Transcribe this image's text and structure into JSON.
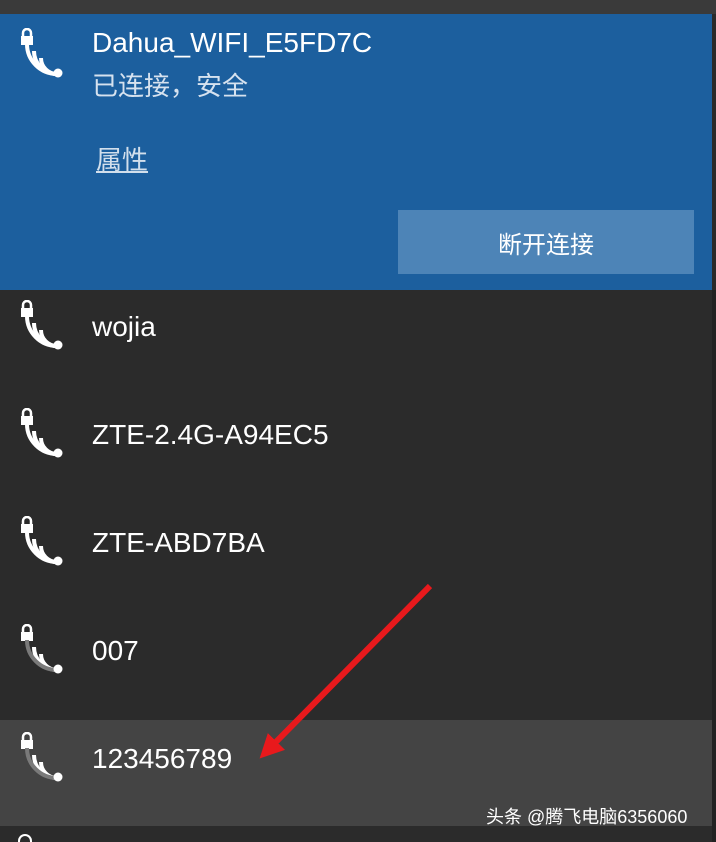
{
  "connected": {
    "ssid": "Dahua_WIFI_E5FD7C",
    "status": "已连接，安全",
    "properties_label": "属性",
    "disconnect_label": "断开连接",
    "icon": "secured-wifi-icon",
    "accent": "#1c5f9e"
  },
  "networks": [
    {
      "ssid": "wojia",
      "icon": "secured-wifi-icon",
      "signal_bars": 4
    },
    {
      "ssid": "ZTE-2.4G-A94EC5",
      "icon": "secured-wifi-icon",
      "signal_bars": 4
    },
    {
      "ssid": "ZTE-ABD7BA",
      "icon": "secured-wifi-icon",
      "signal_bars": 4
    },
    {
      "ssid": "007",
      "icon": "secured-wifi-icon",
      "signal_bars": 2
    },
    {
      "ssid": "123456789",
      "icon": "secured-wifi-icon",
      "signal_bars": 2,
      "highlighted": true
    }
  ],
  "watermark": "头条 @腾飞电脑6356060",
  "annotation_color": "#e8191c"
}
